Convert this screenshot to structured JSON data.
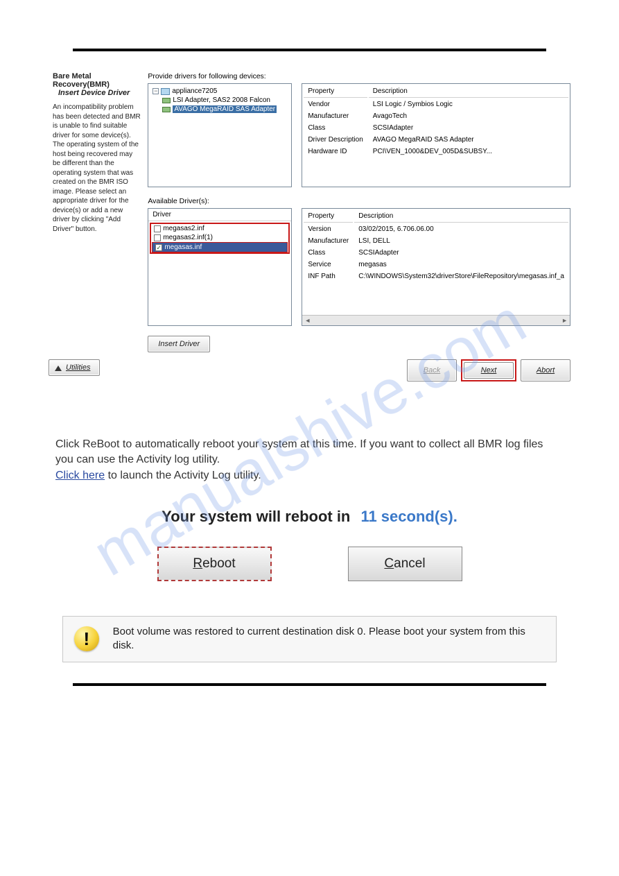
{
  "watermark": "manualshive.com",
  "bmr": {
    "title": "Bare Metal Recovery(BMR)",
    "subtitle": "Insert Device Driver",
    "description": "An incompatibility problem has been detected and BMR is unable to find suitable driver for some device(s). The operating system of the host being recovered may be different than the operating system that was created on the BMR ISO image. Please select an appropriate driver for the device(s) or add a new driver by clicking \"Add Driver\" button."
  },
  "deviceSection": {
    "provideLabel": "Provide drivers for following devices:",
    "tree": {
      "root": "appliance7205",
      "item1": "LSI Adapter, SAS2 2008 Falcon",
      "item2": "AVAGO MegaRAID SAS Adapter"
    },
    "propHeader1": "Property",
    "propHeader2": "Description",
    "rows": [
      {
        "k": "Vendor",
        "v": "LSI Logic / Symbios Logic"
      },
      {
        "k": "Manufacturer",
        "v": "AvagoTech"
      },
      {
        "k": "Class",
        "v": "SCSIAdapter"
      },
      {
        "k": "Driver Description",
        "v": "AVAGO MegaRAID SAS Adapter"
      },
      {
        "k": "Hardware ID",
        "v": "PCI\\VEN_1000&DEV_005D&SUBSY..."
      }
    ]
  },
  "driverSection": {
    "availableLabel": "Available Driver(s):",
    "driverHeader": "Driver",
    "drivers": [
      {
        "name": "megasas2.inf",
        "checked": false,
        "selected": false
      },
      {
        "name": "megasas2.inf(1)",
        "checked": false,
        "selected": false
      },
      {
        "name": "megasas.inf",
        "checked": true,
        "selected": true
      }
    ],
    "propHeader1": "Property",
    "propHeader2": "Description",
    "rows": [
      {
        "k": "Version",
        "v": "03/02/2015, 6.706.06.00"
      },
      {
        "k": "Manufacturer",
        "v": "LSI, DELL"
      },
      {
        "k": "Class",
        "v": "SCSIAdapter"
      },
      {
        "k": "Service",
        "v": "megasas"
      },
      {
        "k": "INF Path",
        "v": "C:\\WINDOWS\\System32\\driverStore\\FileRepository\\megasas.inf_a"
      }
    ],
    "insertBtn": "Insert Driver"
  },
  "nav": {
    "utilities": "Utilities",
    "back": "Back",
    "next": "Next",
    "abort": "Abort"
  },
  "reboot": {
    "line": "Click ReBoot to automatically reboot your system at this time. If you want to collect all BMR log files you can use the Activity log utility.",
    "linkText": "Click here",
    "linkTail": " to launch the Activity Log utility.",
    "countdownLabel": "Your system will reboot in",
    "countdownValue": "11 second(s).",
    "rebootBtn": "Reboot",
    "cancelBtn": "Cancel"
  },
  "info": {
    "text": "Boot volume was restored to current destination disk 0. Please boot your system from this disk."
  }
}
